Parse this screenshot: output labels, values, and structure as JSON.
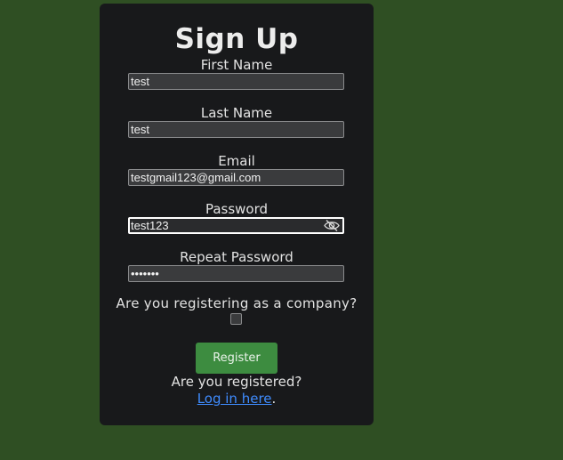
{
  "form": {
    "title": "Sign Up",
    "fields": [
      {
        "label": "First Name",
        "value": "test"
      },
      {
        "label": "Last Name",
        "value": "test"
      },
      {
        "label": "Email",
        "value": "testgmail123@gmail.com"
      },
      {
        "label": "Password",
        "value": "test123",
        "toggle_icon": "eye-slash-icon"
      },
      {
        "label": "Repeat Password",
        "value": "•••••••"
      }
    ],
    "company_question": "Are you registering as a company?",
    "company_checked": false,
    "register_label": "Register",
    "registered_question": "Are you registered?",
    "login_link_text": "Log in here",
    "login_suffix": "."
  },
  "colors": {
    "background": "#2f4f23",
    "card": "#18191b",
    "button": "#3d8c40",
    "link": "#3f8cff"
  }
}
